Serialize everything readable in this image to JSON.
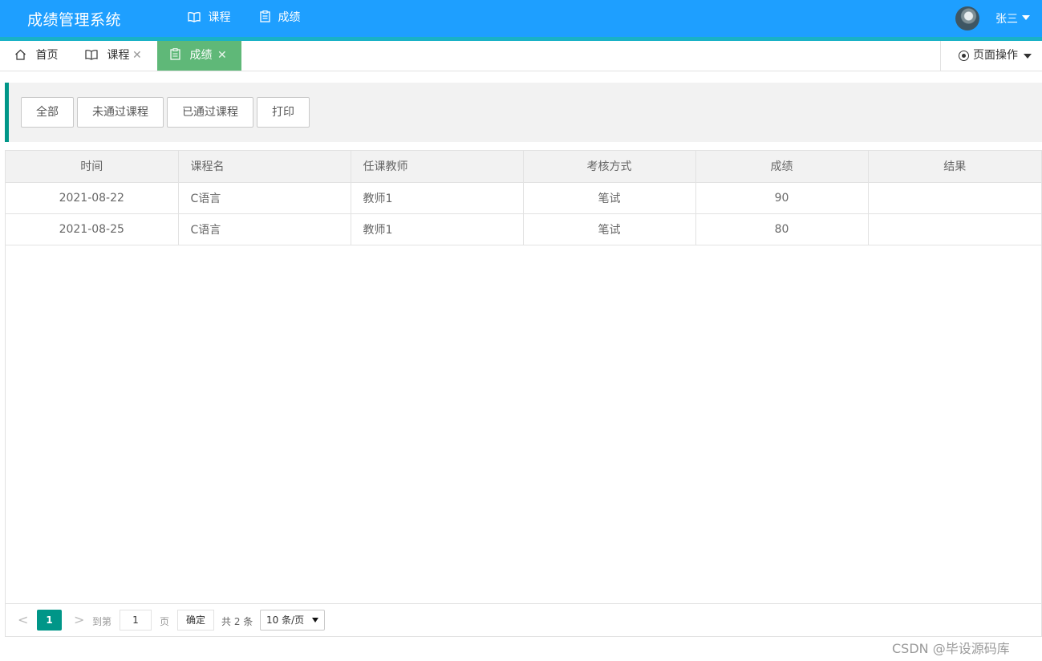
{
  "header": {
    "logo": "成绩管理系统",
    "nav": [
      {
        "label": "课程",
        "icon": "book-icon"
      },
      {
        "label": "成绩",
        "icon": "clipboard-icon",
        "active": true
      }
    ],
    "user": {
      "name": "张三"
    }
  },
  "tabs": {
    "items": [
      {
        "label": "首页",
        "icon": "home-icon",
        "closable": false
      },
      {
        "label": "课程",
        "icon": "book-icon",
        "closable": true,
        "close_glyph": "✕"
      },
      {
        "label": "成绩",
        "icon": "clipboard-icon",
        "closable": true,
        "active": true,
        "close_glyph": "✕"
      }
    ],
    "page_ops_label": "页面操作"
  },
  "toolbar": {
    "buttons": [
      "全部",
      "未通过课程",
      "已通过课程",
      "打印"
    ]
  },
  "table": {
    "columns": [
      "时间",
      "课程名",
      "任课教师",
      "考核方式",
      "成绩",
      "结果"
    ],
    "rows": [
      [
        "2021-08-22",
        "C语言",
        "教师1",
        "笔试",
        "90",
        ""
      ],
      [
        "2021-08-25",
        "C语言",
        "教师1",
        "笔试",
        "80",
        ""
      ]
    ]
  },
  "pager": {
    "prev": "<",
    "current": "1",
    "next": ">",
    "goto_label": "到第",
    "goto_value": "1",
    "page_label": "页",
    "confirm": "确定",
    "total": "共 2 条",
    "page_size": "10 条/页"
  },
  "watermark": "CSDN @毕设源码库",
  "colors": {
    "header": "#1e9fff",
    "accent": "#009688",
    "active_tab": "#5fb878"
  }
}
